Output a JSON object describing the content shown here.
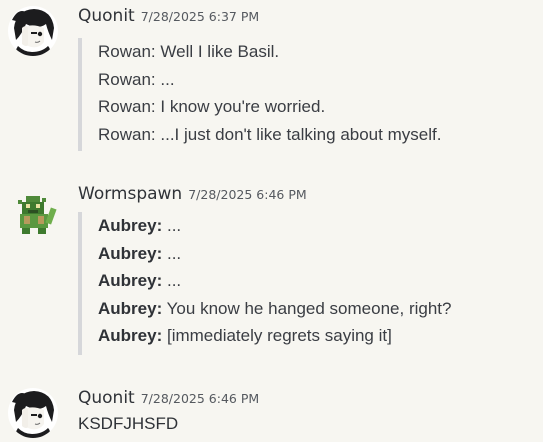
{
  "messages": [
    {
      "username": "Quonit",
      "timestamp": "7/28/2025 6:37 PM",
      "avatar_icon": "anime-dark-haired-character-avatar",
      "quote_lines": [
        {
          "speaker": "Rowan:",
          "text": "Well I like Basil."
        },
        {
          "speaker": "Rowan:",
          "text": "..."
        },
        {
          "speaker": "Rowan:",
          "text": "I know you're worried."
        },
        {
          "speaker": "Rowan:",
          "text": "...I just don't like talking about myself."
        }
      ]
    },
    {
      "username": "Wormspawn",
      "timestamp": "7/28/2025 6:46 PM",
      "avatar_icon": "green-pixel-creature-avatar",
      "quote_lines": [
        {
          "speaker": "Aubrey:",
          "text": "..."
        },
        {
          "speaker": "Aubrey:",
          "text": "..."
        },
        {
          "speaker": "Aubrey:",
          "text": "..."
        },
        {
          "speaker": "Aubrey:",
          "text": "You know he hanged someone, right?"
        },
        {
          "speaker": "Aubrey:",
          "text": "[immediately regrets saying it]"
        }
      ]
    },
    {
      "username": "Quonit",
      "timestamp": "7/28/2025 6:46 PM",
      "avatar_icon": "anime-dark-haired-character-avatar",
      "text": "KSDFJHSFD"
    }
  ]
}
